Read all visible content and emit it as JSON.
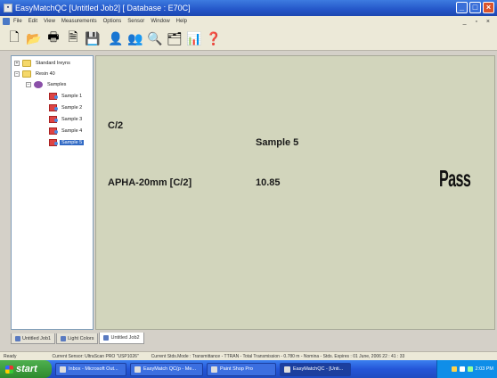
{
  "window": {
    "title": "EasyMatchQC  [Untitled Job2]  [ Database : E70C]",
    "buttons": {
      "minimize": "_",
      "maximize": "□",
      "close": "×"
    }
  },
  "menu": {
    "items": [
      "File",
      "Edit",
      "View",
      "Measurements",
      "Options",
      "Sensor",
      "Window",
      "Help"
    ],
    "mdi_controls": "_ ▫ ×"
  },
  "toolbar": {
    "buttons": [
      {
        "name": "new-icon",
        "glyph": "🗋"
      },
      {
        "name": "open-icon",
        "glyph": "📂"
      },
      {
        "name": "print-icon",
        "glyph": "🖶"
      },
      {
        "name": "preview-icon",
        "glyph": "🗎"
      },
      {
        "name": "save-icon",
        "glyph": "💾"
      },
      {
        "name": "standard-icon",
        "glyph": "👤"
      },
      {
        "name": "sample-icon",
        "glyph": "👥"
      },
      {
        "name": "measure-icon",
        "glyph": "🔍"
      },
      {
        "name": "export-icon",
        "glyph": "🗂"
      },
      {
        "name": "trend-icon",
        "glyph": "📊"
      },
      {
        "name": "help-icon",
        "glyph": "❓"
      }
    ]
  },
  "tree": {
    "standard": "Standard Ireyns",
    "group": "Resin 40",
    "samples": "Samples",
    "items": [
      "Sample 1",
      "Sample 2",
      "Sample 3",
      "Sample 4",
      "Sample 5"
    ],
    "selected_index": 4
  },
  "content": {
    "scale": "C/2",
    "sample_name": "Sample 5",
    "index_label": "APHA-20mm [C/2]",
    "index_value": "10.85",
    "result": "Pass"
  },
  "tabs": [
    {
      "label": "Untitled Job1",
      "active": false
    },
    {
      "label": "Light Colors",
      "active": false
    },
    {
      "label": "Untitled Job2",
      "active": true
    }
  ],
  "status": {
    "ready": "Ready",
    "sensor": "Current Sensor: UltraScan PRO \"USP1026\"",
    "mode": "Current Stds.Mode : Transmittance - TTRAN - Total Transmission - 0.780 m - Nomina - Stds. Expires : 01 June, 2006 22 : 41 : 33"
  },
  "taskbar": {
    "start": "start",
    "items": [
      {
        "label": "Inbox - Microsoft Out...",
        "active": false
      },
      {
        "label": "EasyMatch QC(p - Me...",
        "active": false
      },
      {
        "label": "Paint Shop Pro",
        "active": false
      },
      {
        "label": "EasyMatchQC - [Unti...",
        "active": true
      }
    ],
    "clock": "2:03 PM"
  }
}
